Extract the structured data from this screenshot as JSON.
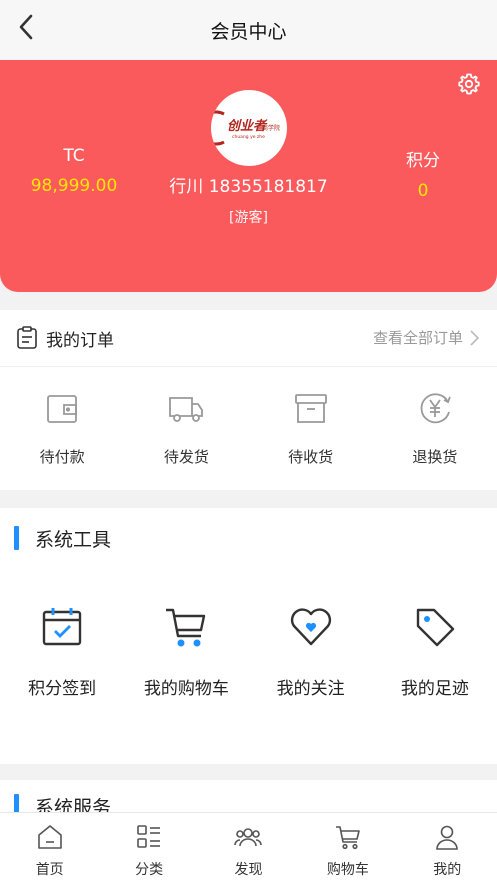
{
  "header": {
    "title": "会员中心"
  },
  "profile": {
    "tc_label": "TC",
    "tc_value": "98,999.00",
    "points_label": "积分",
    "points_value": "0",
    "user_line": "行川 18355181817",
    "role": "[游客]",
    "logo_text": "创业者",
    "logo_sub": "商学院",
    "logo_pinyin": "chuang ye zhe"
  },
  "orders": {
    "title": "我的订单",
    "view_all": "查看全部订单",
    "items": [
      {
        "label": "待付款",
        "icon": "wallet-icon"
      },
      {
        "label": "待发货",
        "icon": "truck-icon"
      },
      {
        "label": "待收货",
        "icon": "box-icon"
      },
      {
        "label": "退换货",
        "icon": "yen-refresh-icon"
      }
    ]
  },
  "tools": {
    "title": "系统工具",
    "items": [
      {
        "label": "积分签到",
        "icon": "calendar-check-icon"
      },
      {
        "label": "我的购物车",
        "icon": "cart-icon"
      },
      {
        "label": "我的关注",
        "icon": "heart-icon"
      },
      {
        "label": "我的足迹",
        "icon": "tag-icon"
      }
    ]
  },
  "services": {
    "title": "系统服务"
  },
  "tabbar": {
    "items": [
      {
        "label": "首页",
        "icon": "home-icon"
      },
      {
        "label": "分类",
        "icon": "category-icon"
      },
      {
        "label": "发现",
        "icon": "discover-icon"
      },
      {
        "label": "购物车",
        "icon": "cart-icon"
      },
      {
        "label": "我的",
        "icon": "user-icon"
      }
    ]
  },
  "colors": {
    "brand_red": "#fb5a5c",
    "accent_blue": "#1e90ff",
    "value_yellow": "#ffe600"
  }
}
